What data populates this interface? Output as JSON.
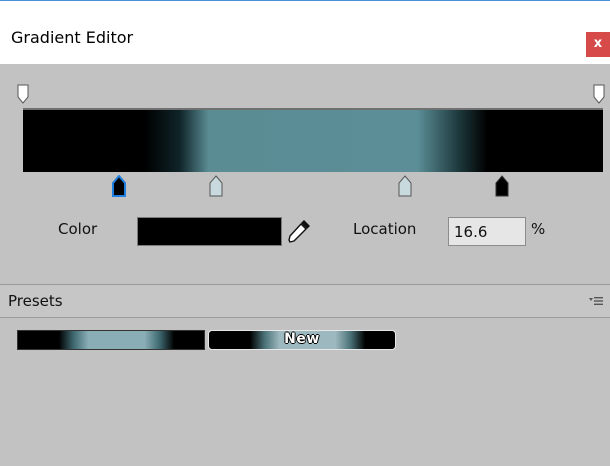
{
  "window": {
    "title": "Gradient Editor",
    "close_label": "x",
    "close_color": "#d64a4a"
  },
  "editor": {
    "alpha_keys": [
      {
        "location": 0
      },
      {
        "location": 100
      }
    ],
    "color_keys": [
      {
        "location": 16.6,
        "color": "#000000",
        "selected": true
      },
      {
        "location": 32,
        "color": "#5a8c94",
        "selected": false
      },
      {
        "location": 68,
        "color": "#5a8c94",
        "selected": false
      },
      {
        "location": 82,
        "color": "#000000",
        "selected": false
      }
    ],
    "color_label": "Color",
    "color_value": "#000000",
    "location_label": "Location",
    "location_value": "16.6",
    "percent_label": "%"
  },
  "presets": {
    "header": "Presets",
    "menu_icon": "menu-dropdown-icon",
    "new_label": "New"
  }
}
